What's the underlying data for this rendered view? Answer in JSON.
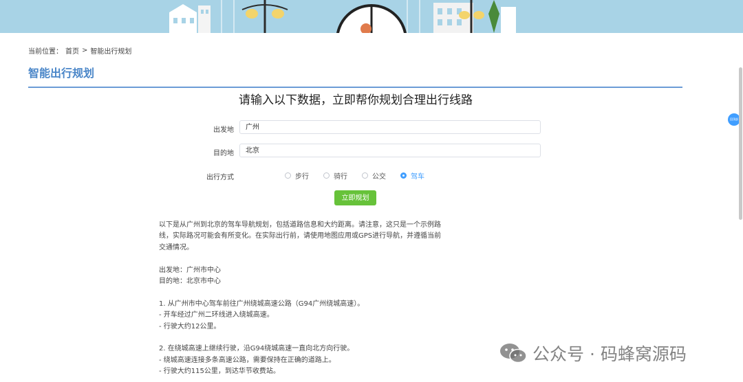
{
  "breadcrumb": {
    "prefix": "当前位置：",
    "home": "首页",
    "separator": ">",
    "current": "智能出行规划"
  },
  "page_title": "智能出行规划",
  "form": {
    "heading": "请输入以下数据，立即帮你规划合理出行线路",
    "origin": {
      "label": "出发地",
      "value": "广州"
    },
    "destination": {
      "label": "目的地",
      "value": "北京"
    },
    "mode": {
      "label": "出行方式",
      "options": [
        "步行",
        "骑行",
        "公交",
        "驾车"
      ],
      "selected": "驾车"
    },
    "submit_label": "立即规划"
  },
  "result": {
    "intro": "以下是从广州到北京的驾车导航规划，包括道路信息和大约距离。请注意，这只是一个示例路线，实际路况可能会有所变化。在实际出行前，请使用地图应用或GPS进行导航，并遵循当前交通情况。",
    "start": "出发地：广州市中心",
    "end": "目的地：北京市中心",
    "step1_title": "1. 从广州市中心驾车前往广州绕城高速公路（G94广州绕城高速）。",
    "step1_a": "- 开车经过广州二环线进入绕城高速。",
    "step1_b": "- 行驶大约12公里。",
    "step2_title": "2. 在绕城高速上继续行驶，沿G94绕城高速一直向北方向行驶。",
    "step2_a": "- 绕城高速连接多条高速公路，需要保持在正确的道路上。",
    "step2_b": "- 行驶大约115公里，到达华节收费站。"
  },
  "side_badge": "回顶部",
  "watermark": "公众号 · 码蜂窝源码",
  "colors": {
    "accent": "#4a86c8",
    "primary": "#409eff",
    "success": "#67c23a",
    "banner": "#a8d3e6"
  }
}
